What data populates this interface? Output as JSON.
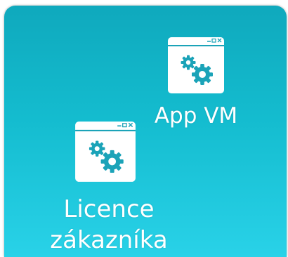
{
  "colors": {
    "panel_top": "#0fa9bd",
    "panel_bottom": "#29d2e8",
    "icon_fill": "#ffffff",
    "gear_color": "#1ba3b8"
  },
  "nodes": [
    {
      "label": "App VM",
      "icon": "app-window-gears-icon"
    },
    {
      "label_line1": "Licence",
      "label_line2": "zákazníka",
      "icon": "app-window-gears-icon"
    }
  ]
}
